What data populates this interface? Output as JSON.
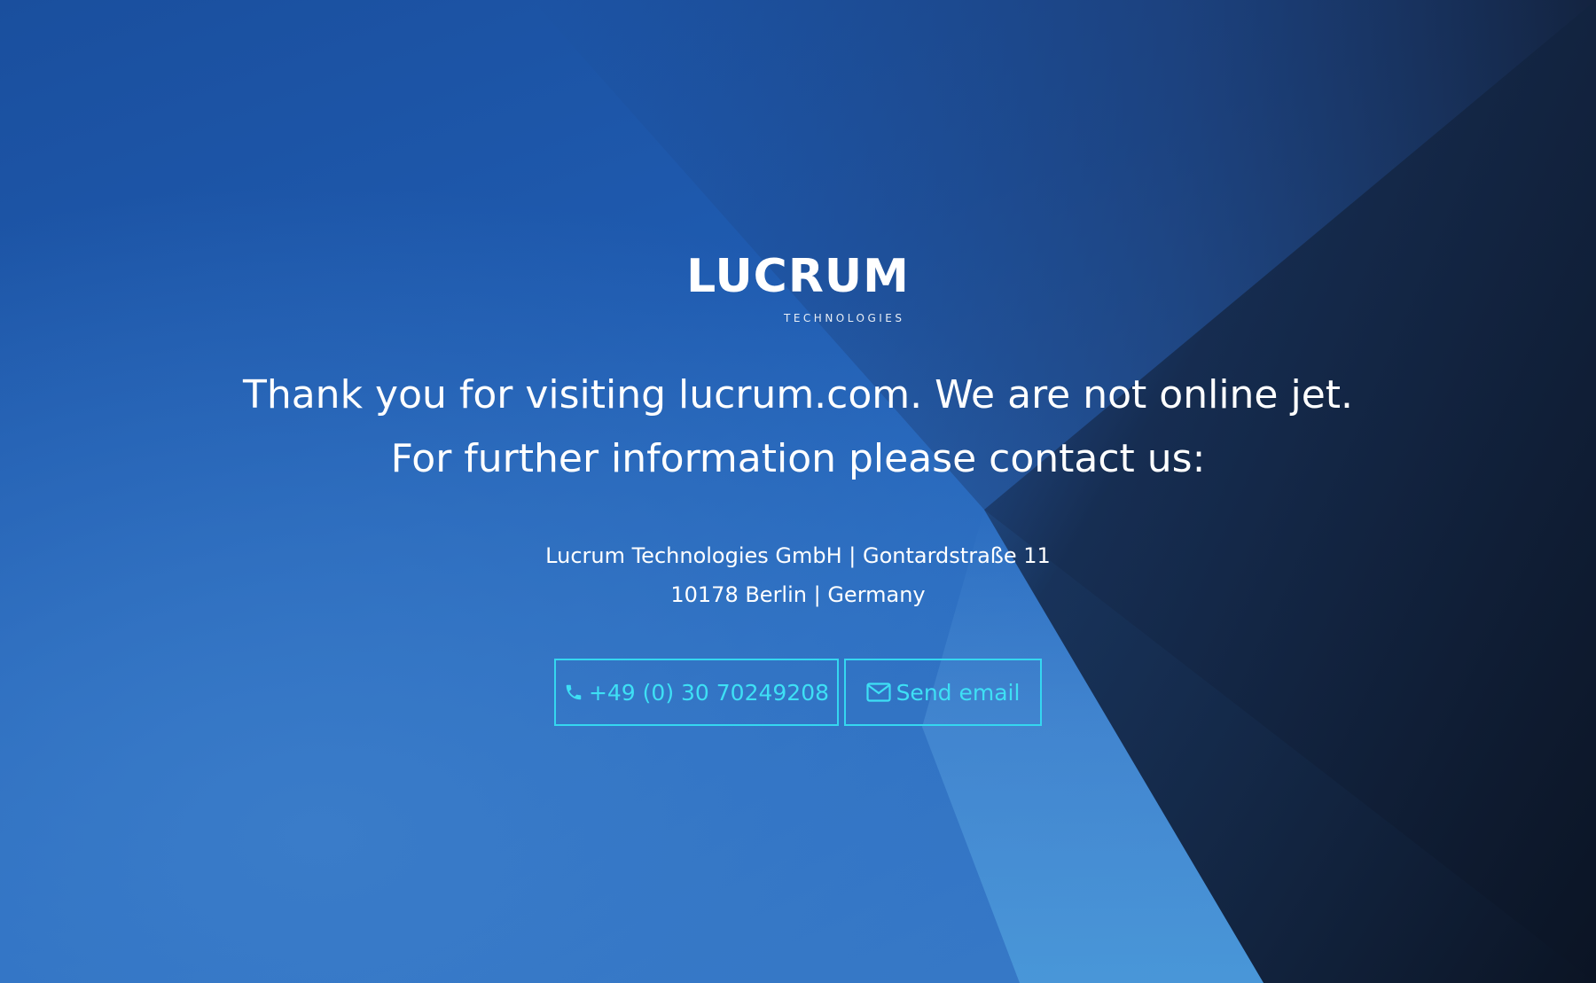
{
  "brand": {
    "name": "LUCRUM",
    "tagline": "TECHNOLOGIES"
  },
  "headline": {
    "line1": "Thank you for visiting lucrum.com. We are not online jet.",
    "line2": "For further information please contact us:"
  },
  "address": {
    "line1": "Lucrum Technologies GmbH | Gontardstraße 11",
    "line2": "10178 Berlin | Germany"
  },
  "buttons": {
    "phone": {
      "label": "+49 (0) 30 70249208",
      "icon": "phone-icon"
    },
    "email": {
      "label": "Send email",
      "icon": "envelope-icon"
    }
  },
  "colors": {
    "accent": "#3ee0f5",
    "background_blue": "#1f56a3",
    "background_dark": "#0b1424"
  }
}
